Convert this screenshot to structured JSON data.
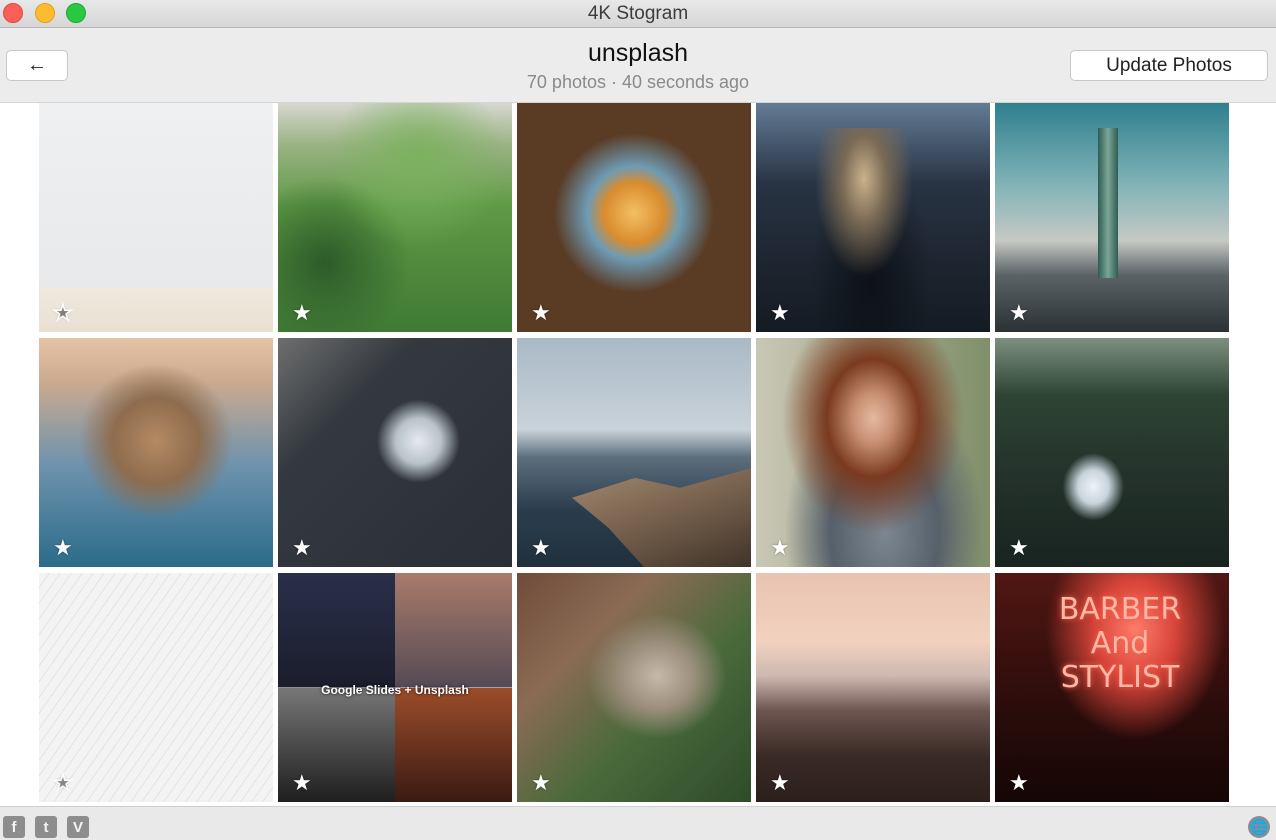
{
  "window": {
    "title": "4K Stogram"
  },
  "header": {
    "back_icon": "←",
    "account_name": "unsplash",
    "subtitle": "70 photos · 40 seconds ago",
    "update_label": "Update Photos"
  },
  "photos": [
    {
      "name": "white-sand-dunes",
      "starred": false
    },
    {
      "name": "green-valley-road",
      "starred": true
    },
    {
      "name": "blueberry-pancakes",
      "starred": true
    },
    {
      "name": "woman-phone-night",
      "starred": true
    },
    {
      "name": "taipei-skyline",
      "starred": true
    },
    {
      "name": "coastal-cliffs-aerial",
      "starred": true
    },
    {
      "name": "letters-glasses-desk",
      "starred": true
    },
    {
      "name": "lighthouse-headland",
      "starred": true
    },
    {
      "name": "red-hair-portrait",
      "starred": true
    },
    {
      "name": "forest-waterfall",
      "starred": true
    },
    {
      "name": "white-architecture",
      "starred": false
    },
    {
      "name": "collage",
      "starred": true,
      "caption": "Google Slides + Unsplash"
    },
    {
      "name": "monkey-branch",
      "starred": true
    },
    {
      "name": "volcano-sunset",
      "starred": true
    },
    {
      "name": "barber-neon",
      "starred": true,
      "sign_text": "BARBER And STYLIST"
    }
  ],
  "footer": {
    "facebook_glyph": "f",
    "twitter_glyph": "t",
    "vimeo_glyph": "V",
    "globe_glyph": "🌐"
  }
}
